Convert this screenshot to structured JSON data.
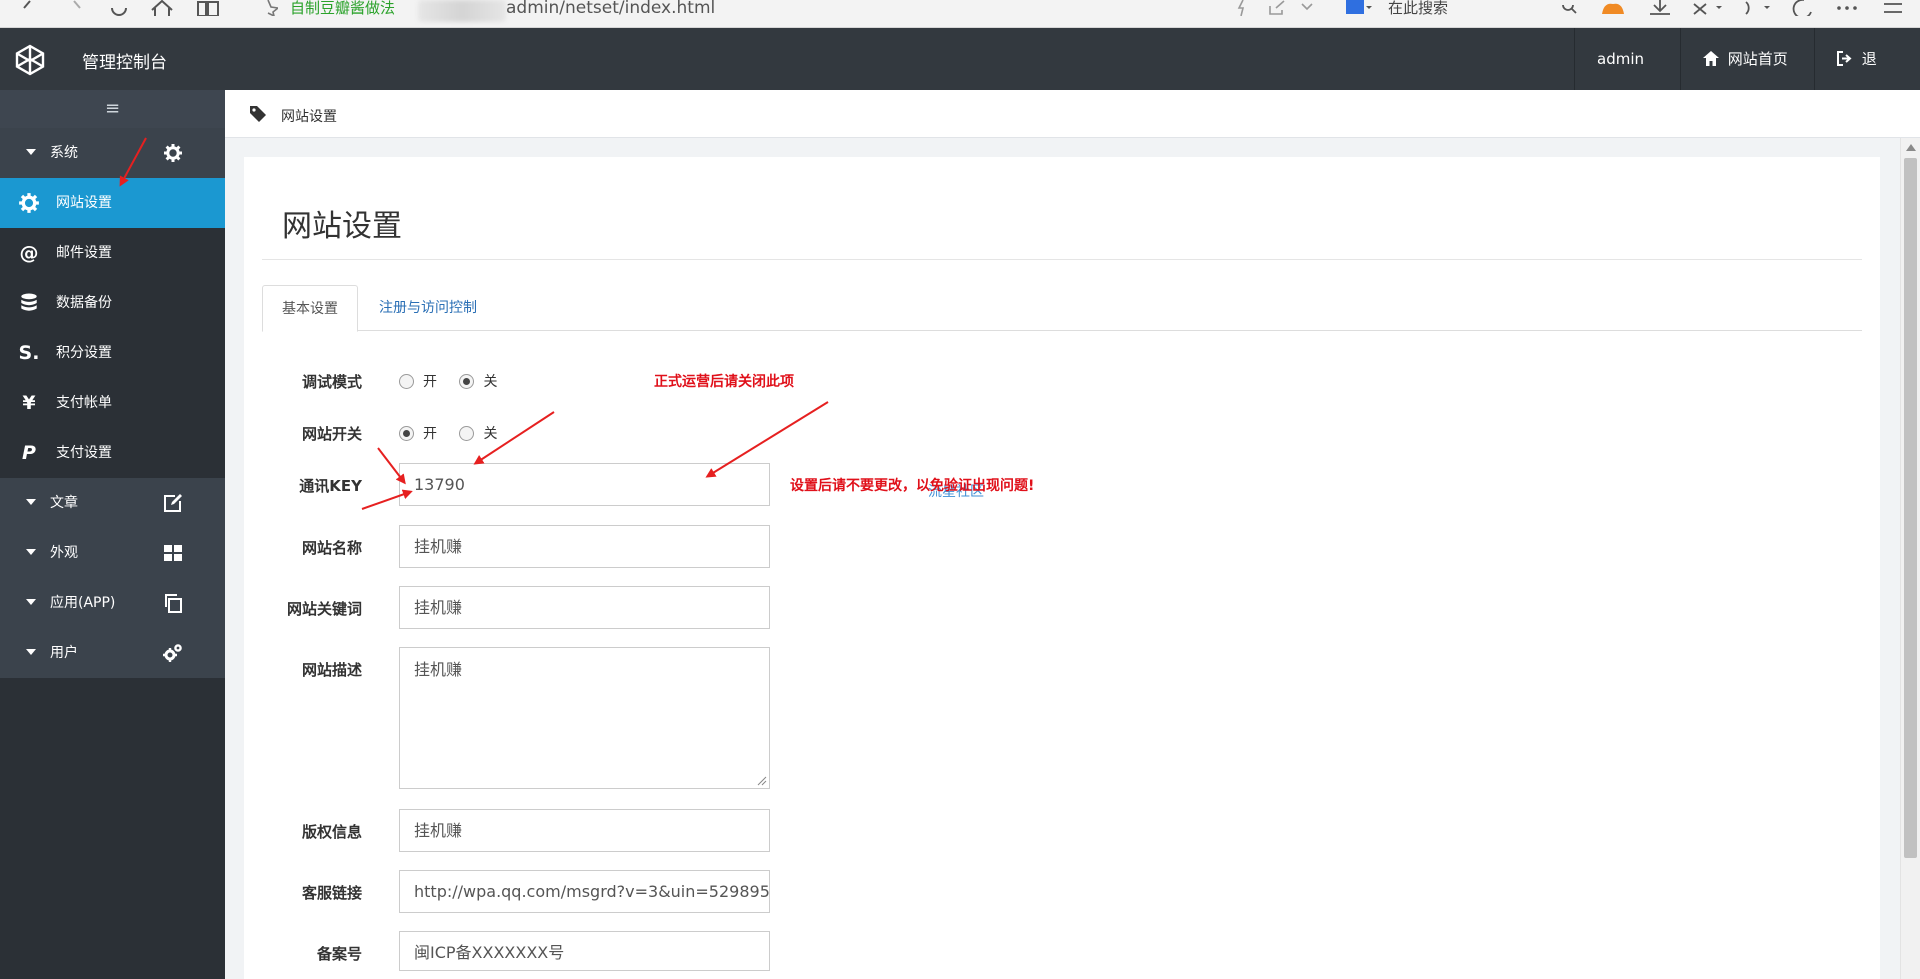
{
  "browser": {
    "bookmark": "自制豆瓣酱做法",
    "url": "admin/netset/index.html",
    "search_placeholder": "在此搜索"
  },
  "topbar": {
    "brand": "管理控制台",
    "user_menu": "admin",
    "home_link": "网站首页",
    "logout": "退出"
  },
  "sidebar": {
    "toggle_icon": "menu-icon",
    "groups": [
      {
        "label": "系统",
        "icon": "gear-icon",
        "items": [
          {
            "label": "网站设置",
            "icon": "gear-icon",
            "active": true
          },
          {
            "label": "邮件设置",
            "icon": "at-icon"
          },
          {
            "label": "数据备份",
            "icon": "database-icon"
          },
          {
            "label": "积分设置",
            "icon": "points-icon"
          },
          {
            "label": "支付帐单",
            "icon": "yen-icon"
          },
          {
            "label": "支付设置",
            "icon": "paypal-icon"
          }
        ]
      },
      {
        "label": "文章",
        "icon": "edit-icon"
      },
      {
        "label": "外观",
        "icon": "grid-icon"
      },
      {
        "label": "应用(APP)",
        "icon": "copy-icon"
      },
      {
        "label": "用户",
        "icon": "cogs-icon"
      }
    ]
  },
  "breadcrumb": {
    "text": "网站设置",
    "icon": "tag-icon"
  },
  "page": {
    "title": "网站设置",
    "tabs": [
      {
        "label": "基本设置",
        "active": true
      },
      {
        "label": "注册与访问控制",
        "active": false
      }
    ]
  },
  "form": {
    "debug_mode": {
      "label": "调试模式",
      "on": "开",
      "off": "关",
      "selected": "关"
    },
    "site_switch": {
      "label": "网站开关",
      "on": "开",
      "off": "关",
      "selected": "开"
    },
    "comm_key": {
      "label": "通讯KEY",
      "value": "13790"
    },
    "site_name": {
      "label": "网站名称",
      "value": "挂机赚"
    },
    "site_keywords": {
      "label": "网站关键词",
      "value": "挂机赚"
    },
    "site_desc": {
      "label": "网站描述",
      "value": "挂机赚"
    },
    "copyright": {
      "label": "版权信息",
      "value": "挂机赚"
    },
    "service_link": {
      "label": "客服链接",
      "value": "http://wpa.qq.com/msgrd?v=3&uin=529895"
    },
    "icp": {
      "label": "备案号",
      "value": "闽ICP备XXXXXXX号"
    }
  },
  "annotations": {
    "debug_note": "正式运营后请关闭此项",
    "key_note": "设置后请不要更改，以免验证出现问题!",
    "watermark": "流星社区"
  },
  "colors": {
    "topbar_bg": "#33393f",
    "sidebar_bg": "#2b3036",
    "active_item": "#1b98d1",
    "annotation_red": "#e0101a"
  }
}
